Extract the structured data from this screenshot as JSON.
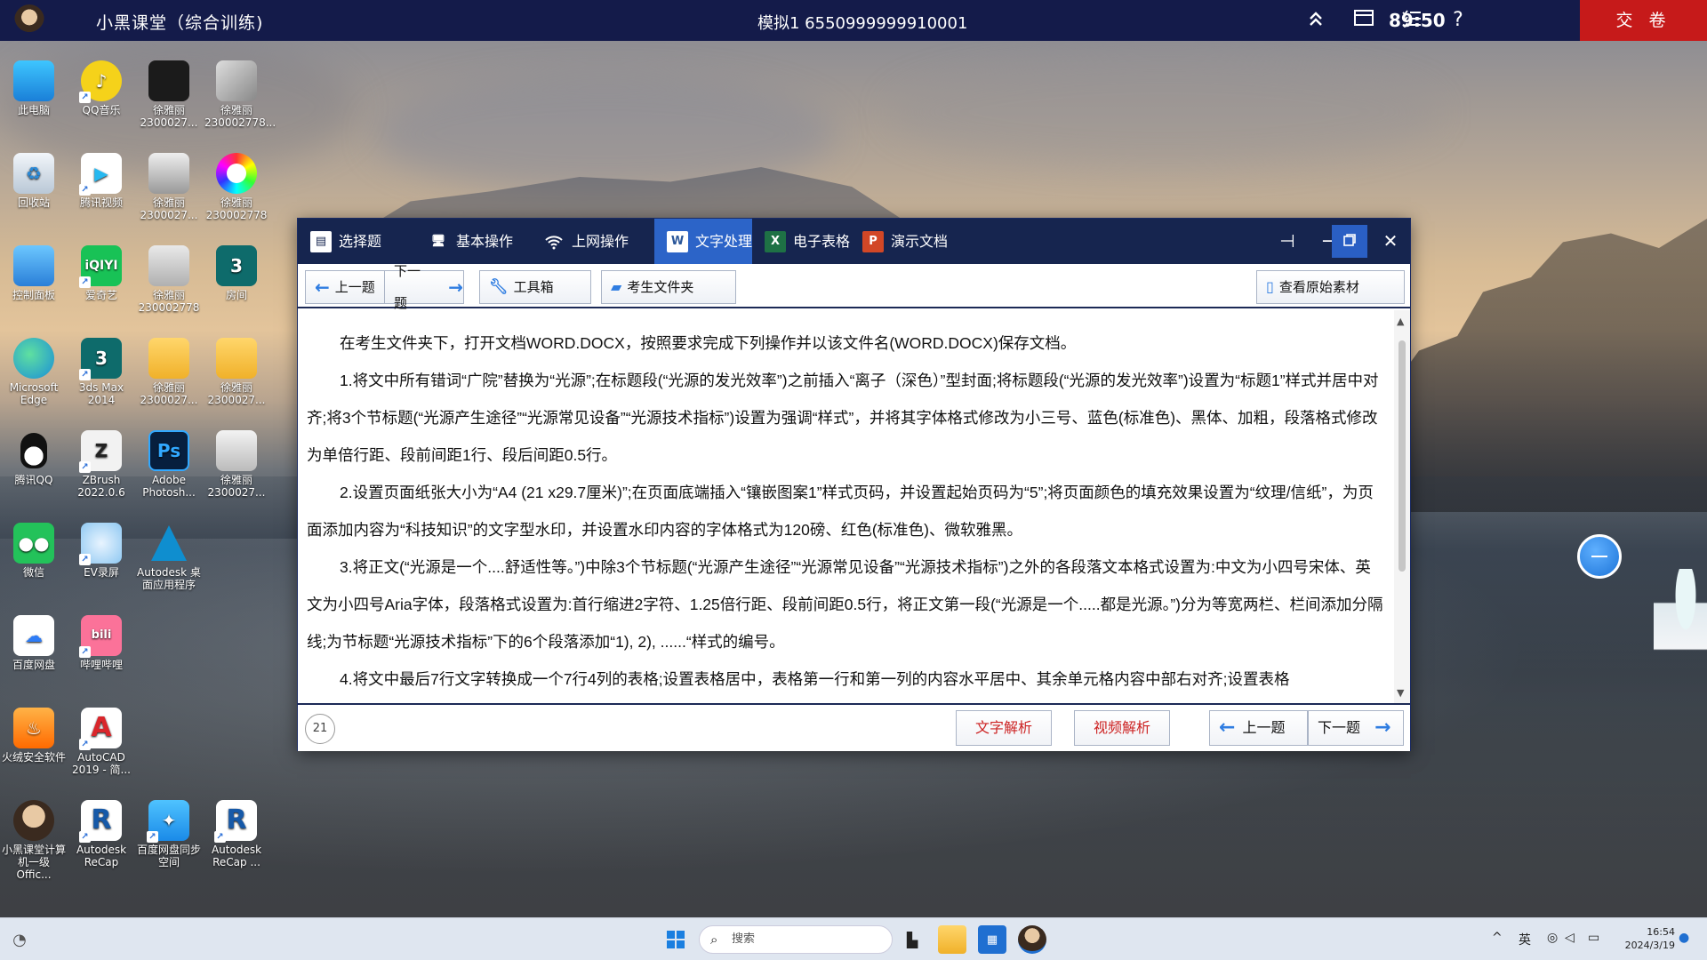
{
  "topbar": {
    "title": "小黑课堂（综合训练)",
    "exam_info": "模拟1  6550999999910001",
    "timer": "89:50",
    "submit_label": "交 卷",
    "icons": [
      "double-up-icon",
      "window-icon",
      "list-icon",
      "help-icon"
    ],
    "help_glyph": "?"
  },
  "desktop_icons": [
    {
      "label": "此电脑"
    },
    {
      "label": "QQ音乐"
    },
    {
      "label": "徐雅丽 2300027..."
    },
    {
      "label": "徐雅丽 230002778..."
    },
    {
      "label": "回收站"
    },
    {
      "label": "腾讯视频"
    },
    {
      "label": "徐雅丽 2300027..."
    },
    {
      "label": "徐雅丽 230002778"
    },
    {
      "label": "控制面板"
    },
    {
      "label": "爱奇艺"
    },
    {
      "label": "徐雅丽 230002778"
    },
    {
      "label": "房间"
    },
    {
      "label": "Microsoft Edge"
    },
    {
      "label": "3ds Max 2014"
    },
    {
      "label": "徐雅丽 2300027..."
    },
    {
      "label": "徐雅丽 2300027..."
    },
    {
      "label": "腾讯QQ"
    },
    {
      "label": "ZBrush 2022.0.6"
    },
    {
      "label": "Adobe Photosh..."
    },
    {
      "label": "徐雅丽 2300027..."
    },
    {
      "label": "微信"
    },
    {
      "label": "EV录屏"
    },
    {
      "label": "Autodesk 桌面应用程序"
    },
    {
      "label": "百度网盘"
    },
    {
      "label": "哔哩哔哩"
    },
    {
      "label": "火绒安全软件"
    },
    {
      "label": "AutoCAD 2019 - 简..."
    },
    {
      "label": "小黑课堂计算机一级Offic..."
    },
    {
      "label": "Autodesk ReCap"
    },
    {
      "label": "百度网盘同步空间"
    },
    {
      "label": "Autodesk ReCap ..."
    }
  ],
  "window": {
    "tabs": [
      {
        "label": "选择题"
      },
      {
        "label": "基本操作"
      },
      {
        "label": "上网操作"
      },
      {
        "label": "文字处理"
      },
      {
        "label": "电子表格"
      },
      {
        "label": "演示文档"
      }
    ],
    "toolbar": {
      "prev": "上一题",
      "next": "下一题",
      "toolbox": "工具箱",
      "folder": "考生文件夹",
      "view_source": "查看原始素材"
    },
    "question_text": [
      "在考生文件夹下，打开文档WORD.DOCX，按照要求完成下列操作并以该文件名(WORD.DOCX)保存文档。",
      "1.将文中所有错词“广院”替换为“光源”;在标题段(“光源的发光效率”)之前插入“离子（深色）”型封面;将标题段(“光源的发光效率”)设置为“标题1”样式并居中对齐;将3个节标题(“光源产生途径”“光源常见设备”“光源技术指标”)设置为强调“样式”，并将其字体格式修改为小三号、蓝色(标准色)、黑体、加粗，段落格式修改为单倍行距、段前间距1行、段后间距0.5行。",
      "2.设置页面纸张大小为“A4 (21 x29.7厘米)”;在页面底端插入“镶嵌图案1”样式页码，并设置起始页码为“5”;将页面颜色的填充效果设置为“纹理/信纸”，为页面添加内容为“科技知识”的文字型水印，并设置水印内容的字体格式为120磅、红色(标准色)、微软雅黑。",
      "3.将正文(“光源是一个....舒适性等。”)中除3个节标题(“光源产生途径”“光源常见设备”“光源技术指标”)之外的各段落文本格式设置为:中文为小四号宋体、英文为小四号Aria字体，段落格式设置为:首行缩进2字符、1.25倍行距、段前间距0.5行，将正文第一段(“光源是一个.....都是光源。”)分为等宽两栏、栏间添加分隔线;为节标题“光源技术指标”下的6个段落添加“1), 2), ......“样式的编号。",
      "4.将文中最后7行文字转换成一个7行4列的表格;设置表格居中，表格第一行和第一列的内容水平居中、其余单元格内容中部右对齐;设置表格"
    ],
    "bottom": {
      "question_number": "21",
      "text_analysis": "文字解析",
      "video_analysis": "视频解析",
      "prev": "上一题",
      "next": "下一题"
    },
    "active_tab_color": "#2c64c8",
    "accent_red": "#c61a1a"
  },
  "taskbar": {
    "search_placeholder": "搜索",
    "ime": "英",
    "time": "16:54",
    "date": "2024/3/19"
  }
}
